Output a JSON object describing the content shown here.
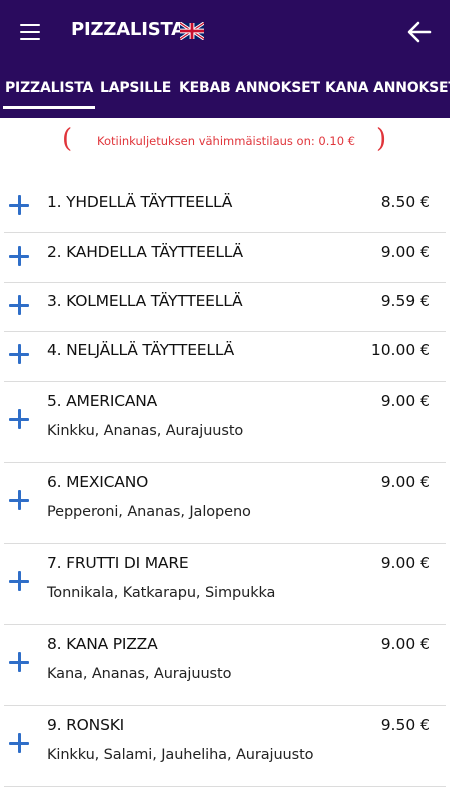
{
  "header": {
    "title": "PIZZALISTA",
    "language_icon": "uk-flag-icon",
    "menu_icon": "hamburger-menu-icon",
    "back_icon": "arrow-left-icon",
    "background_color": "#2a0b5e"
  },
  "tabs": [
    {
      "label": "PIZZALISTA",
      "active": true
    },
    {
      "label": "LAPSILLE",
      "active": false
    },
    {
      "label": "KEBAB ANNOKSET",
      "active": false
    },
    {
      "label": "KANA ANNOKSET",
      "active": false
    }
  ],
  "notice": {
    "text": "Kotiinkuljetuksen vähimmäistilaus on: 0.10 €",
    "color": "#e0353b"
  },
  "accent_color": "#2f6ec8",
  "items": [
    {
      "name": "1. YHDELLÄ TÄYTTEELLÄ",
      "price": "8.50 €",
      "description": ""
    },
    {
      "name": "2. KAHDELLA TÄYTTEELLÄ",
      "price": "9.00 €",
      "description": ""
    },
    {
      "name": "3. KOLMELLA TÄYTTEELLÄ",
      "price": "9.59 €",
      "description": ""
    },
    {
      "name": "4. NELJÄLLÄ TÄYTTEELLÄ",
      "price": "10.00 €",
      "description": ""
    },
    {
      "name": "5. AMERICANA",
      "price": "9.00 €",
      "description": "Kinkku, Ananas, Aurajuusto"
    },
    {
      "name": "6. MEXICANO",
      "price": "9.00 €",
      "description": "Pepperoni, Ananas, Jalopeno"
    },
    {
      "name": "7. FRUTTI DI MARE",
      "price": "9.00 €",
      "description": "Tonnikala, Katkarapu, Simpukka"
    },
    {
      "name": "8. KANA PIZZA",
      "price": "9.00 €",
      "description": "Kana, Ananas, Aurajuusto"
    },
    {
      "name": "9. RONSKI",
      "price": "9.50 €",
      "description": "Kinkku, Salami, Jauheliha, Aurajuusto"
    }
  ]
}
